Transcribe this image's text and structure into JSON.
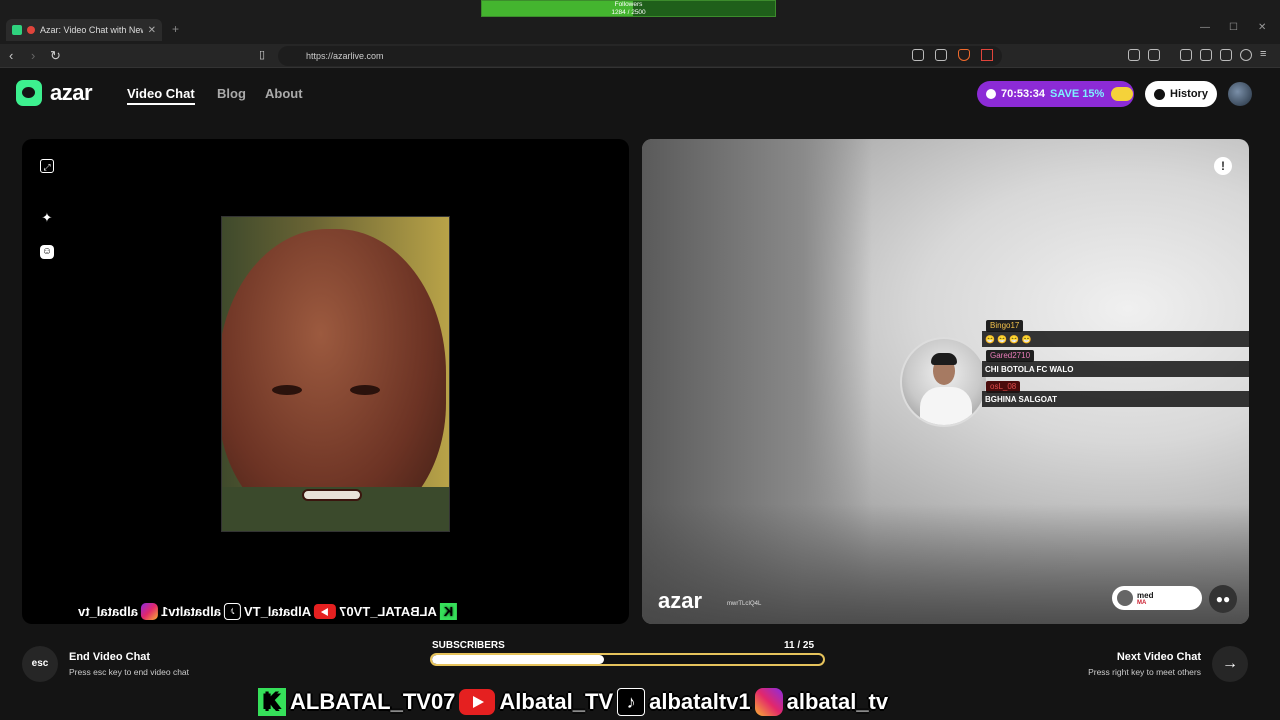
{
  "browser": {
    "tab_title": "Azar: Video Chat with New Pe",
    "url": "https://azarlive.com",
    "followers_label": "Followers",
    "followers_count": "1284 / 2500",
    "followers_progress": 0.514
  },
  "header": {
    "logo_text": "azar",
    "nav": [
      "Video Chat",
      "Blog",
      "About"
    ],
    "promo_timer": "70:53:34",
    "promo_label": "SAVE 15%",
    "history_label": "History"
  },
  "right_panel": {
    "watermark": "azar",
    "watermark_id": "mwrTLcIQ4L",
    "partner_name": "med",
    "partner_country": "MA"
  },
  "stream_chat": [
    {
      "user": "Bingo17",
      "message": "😁 😁 😁 😁"
    },
    {
      "user": "Gared2710",
      "message": "CHI BOTOLA FC WALO"
    },
    {
      "user": "osL_08",
      "message": "BGHINA SALGOAT"
    }
  ],
  "bottom": {
    "esc_label": "esc",
    "end_title": "End Video Chat",
    "end_sub": "Press esc key to end video chat",
    "subscribers_label": "SUBSCRIBERS",
    "subscribers_count": "11  / 25",
    "subscribers_progress": 0.44,
    "next_title": "Next Video Chat",
    "next_sub": "Press right key to meet others"
  },
  "social": {
    "kick": "ALBATAL_TV07",
    "youtube": "Albatal_TV",
    "tiktok": "albataltv1",
    "instagram": "albatal_tv"
  },
  "colors": {
    "accent_green": "#3df08f",
    "promo_purple": "#8c2bd6",
    "progress_border": "#e6c35c"
  }
}
